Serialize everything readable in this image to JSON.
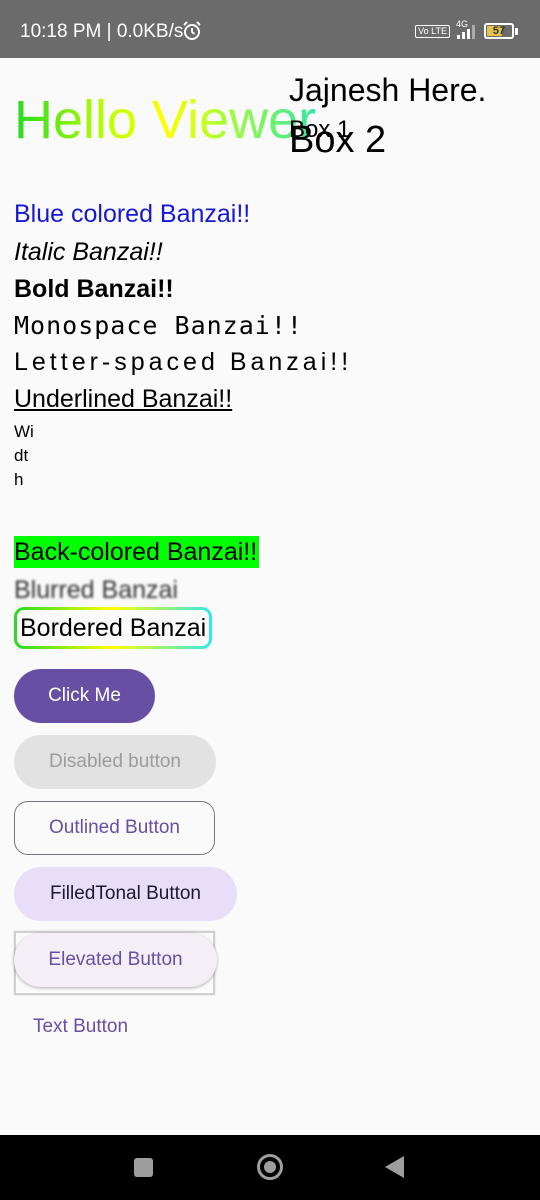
{
  "status_bar": {
    "time_speed": "10:18 PM | 0.0KB/s",
    "volte": "Vo LTE",
    "network": "4G",
    "battery_level": "57"
  },
  "header": {
    "hello": "Hello Viewer",
    "jajnesh": "Jajnesh Here.",
    "box1": "Box 1",
    "box2": "Box 2"
  },
  "texts": {
    "blue": "Blue colored Banzai!!",
    "italic": "Italic Banzai!!",
    "bold": "Bold Banzai!!",
    "monospace": "Monospace Banzai!!",
    "letter_spaced": "Letter-spaced Banzai!!",
    "underlined": "Underlined Banzai!!",
    "width": "Width",
    "back_colored": "Back-colored Banzai!!",
    "blurred": "Blurred Banzai",
    "bordered": "Bordered Banzai"
  },
  "buttons": {
    "click_me": "Click Me",
    "disabled": "Disabled button",
    "outlined": "Outlined Button",
    "filled_tonal": "FilledTonal Button",
    "elevated": "Elevated Button",
    "text": "Text Button"
  },
  "colors": {
    "primary": "#6750a4",
    "blue_text": "#1717d6",
    "back_color": "#00ff00",
    "tonal": "#e8def8"
  }
}
